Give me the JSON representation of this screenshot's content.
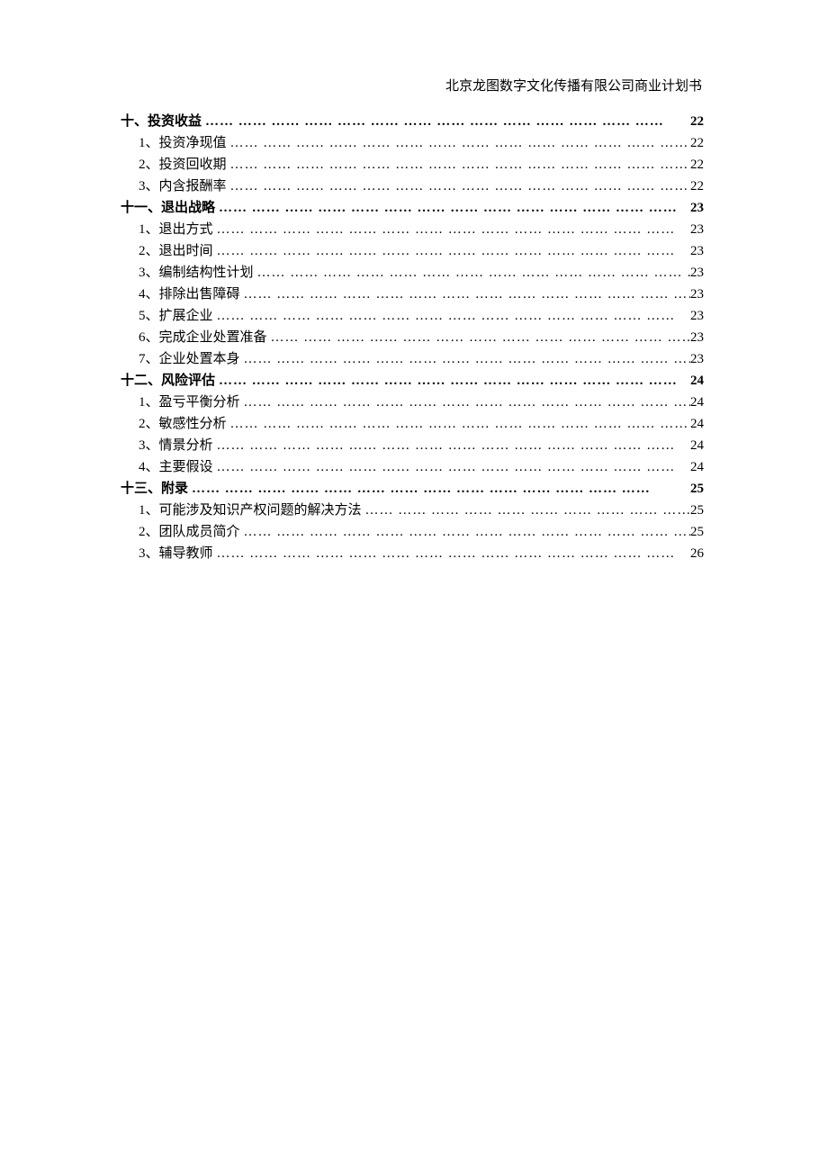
{
  "header": "北京龙图数字文化传播有限公司商业计划书",
  "leaders": "…… …… …… …… …… …… …… …… …… …… …… …… …… ……",
  "sections": [
    {
      "label": "十、投资收益",
      "page": "22",
      "items": [
        {
          "label": "1、投资净现值",
          "page": "22"
        },
        {
          "label": "2、投资回收期",
          "page": "22"
        },
        {
          "label": "3、内含报酬率",
          "page": "22"
        }
      ]
    },
    {
      "label": "十一、退出战略",
      "page": "23",
      "items": [
        {
          "label": "1、退出方式",
          "page": "23"
        },
        {
          "label": "2、退出时间",
          "page": "23"
        },
        {
          "label": "3、编制结构性计划",
          "page": "23"
        },
        {
          "label": "4、排除出售障碍",
          "page": "23"
        },
        {
          "label": "5、扩展企业",
          "page": "23"
        },
        {
          "label": "6、完成企业处置准备",
          "page": "23"
        },
        {
          "label": "7、企业处置本身",
          "page": "23"
        }
      ]
    },
    {
      "label": "十二、风险评估",
      "page": "24",
      "items": [
        {
          "label": "1、盈亏平衡分析",
          "page": "24"
        },
        {
          "label": "2、敏感性分析",
          "page": "24"
        },
        {
          "label": "3、情景分析",
          "page": "24"
        },
        {
          "label": "4、主要假设",
          "page": "24"
        }
      ]
    },
    {
      "label": "十三、附录",
      "page": "25",
      "items": [
        {
          "label": "1、可能涉及知识产权问题的解决方法",
          "page": "25"
        },
        {
          "label": "2、团队成员简介",
          "page": "25"
        },
        {
          "label": "3、辅导教师",
          "page": "26"
        }
      ]
    }
  ]
}
